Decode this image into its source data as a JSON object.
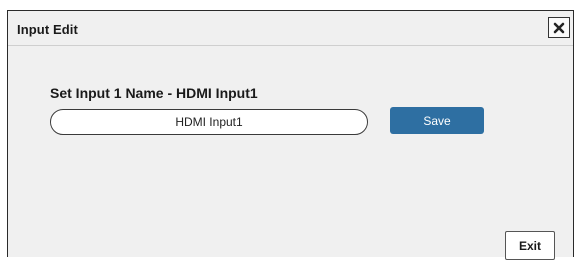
{
  "dialog": {
    "title": "Input Edit",
    "close_icon": "close-icon"
  },
  "form": {
    "label": "Set Input 1 Name - HDMI Input1",
    "input_value": "HDMI Input1",
    "save_label": "Save",
    "exit_label": "Exit"
  },
  "colors": {
    "accent": "#2e6fa2",
    "background": "#f0f0f0"
  }
}
